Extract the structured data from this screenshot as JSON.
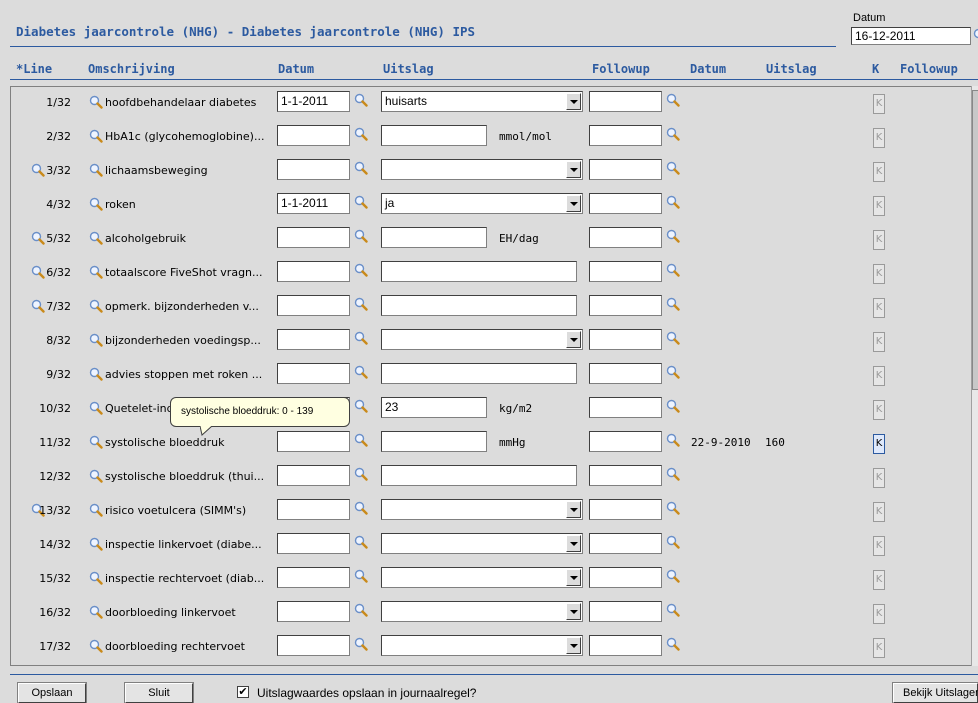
{
  "header": {
    "title": "Diabetes jaarcontrole (NHG) - Diabetes jaarcontrole (NHG) IPS",
    "datum_label": "Datum",
    "datum_value": "16-12-2011"
  },
  "columns": {
    "line": "*Line",
    "omschrijving": "Omschrijving",
    "datum": "Datum",
    "uitslag": "Uitslag",
    "followup": "Followup",
    "datum_prev": "Datum",
    "uitslag_prev": "Uitslag",
    "k": "K",
    "followup_prev": "Followup"
  },
  "rows": [
    {
      "num": "1/32",
      "desc": "hoofdbehandelaar diabetes",
      "date": "1-1-2011",
      "result": "huisarts",
      "unit": "",
      "type": "select",
      "prev_date": "",
      "prev_value": "",
      "row_lens": false
    },
    {
      "num": "2/32",
      "desc": "HbA1c (glycohemoglobine)...",
      "date": "",
      "result": "",
      "unit": "mmol/mol",
      "type": "text",
      "prev_date": "",
      "prev_value": "",
      "row_lens": false
    },
    {
      "num": "3/32",
      "desc": "lichaamsbeweging",
      "date": "",
      "result": "",
      "unit": "",
      "type": "select",
      "prev_date": "",
      "prev_value": "",
      "row_lens": true
    },
    {
      "num": "4/32",
      "desc": "roken",
      "date": "1-1-2011",
      "result": "ja",
      "unit": "",
      "type": "select",
      "prev_date": "",
      "prev_value": "",
      "row_lens": false
    },
    {
      "num": "5/32",
      "desc": "alcoholgebruik",
      "date": "",
      "result": "",
      "unit": "EH/dag",
      "type": "text",
      "prev_date": "",
      "prev_value": "",
      "row_lens": true
    },
    {
      "num": "6/32",
      "desc": "totaalscore FiveShot vragn...",
      "date": "",
      "result": "",
      "unit": "",
      "type": "wide",
      "prev_date": "",
      "prev_value": "",
      "row_lens": true
    },
    {
      "num": "7/32",
      "desc": "opmerk. bijzonderheden v...",
      "date": "",
      "result": "",
      "unit": "",
      "type": "wide",
      "prev_date": "",
      "prev_value": "",
      "row_lens": true
    },
    {
      "num": "8/32",
      "desc": "bijzonderheden voedingsp...",
      "date": "",
      "result": "",
      "unit": "",
      "type": "select",
      "prev_date": "",
      "prev_value": "",
      "row_lens": false
    },
    {
      "num": "9/32",
      "desc": "advies stoppen met roken ...",
      "date": "",
      "result": "",
      "unit": "",
      "type": "wide",
      "prev_date": "",
      "prev_value": "",
      "row_lens": false
    },
    {
      "num": "10/32",
      "desc": "Quetelet-index",
      "date": "",
      "result": "23",
      "unit": "kg/m2",
      "type": "text",
      "prev_date": "",
      "prev_value": "",
      "row_lens": false
    },
    {
      "num": "11/32",
      "desc": "systolische bloeddruk",
      "date": "",
      "result": "",
      "unit": "mmHg",
      "type": "text",
      "prev_date": "22-9-2010",
      "prev_value": "160",
      "row_lens": false
    },
    {
      "num": "12/32",
      "desc": "systolische bloeddruk (thui...",
      "date": "",
      "result": "",
      "unit": "",
      "type": "wide",
      "prev_date": "",
      "prev_value": "",
      "row_lens": false
    },
    {
      "num": "13/32",
      "desc": "risico voetulcera (SIMM's)",
      "date": "",
      "result": "",
      "unit": "",
      "type": "select",
      "prev_date": "",
      "prev_value": "",
      "row_lens": true
    },
    {
      "num": "14/32",
      "desc": "inspectie linkervoet (diabe...",
      "date": "",
      "result": "",
      "unit": "",
      "type": "select",
      "prev_date": "",
      "prev_value": "",
      "row_lens": false
    },
    {
      "num": "15/32",
      "desc": "inspectie rechtervoet (diab...",
      "date": "",
      "result": "",
      "unit": "",
      "type": "select",
      "prev_date": "",
      "prev_value": "",
      "row_lens": false
    },
    {
      "num": "16/32",
      "desc": "doorbloeding linkervoet",
      "date": "",
      "result": "",
      "unit": "",
      "type": "select",
      "prev_date": "",
      "prev_value": "",
      "row_lens": false
    },
    {
      "num": "17/32",
      "desc": "doorbloeding rechtervoet",
      "date": "",
      "result": "",
      "unit": "",
      "type": "select",
      "prev_date": "",
      "prev_value": "",
      "row_lens": false
    }
  ],
  "k_label": "K",
  "tooltip": "systolische bloeddruk: 0 - 139",
  "footer": {
    "save": "Opslaan",
    "close": "Sluit",
    "checkbox_checked": true,
    "checkbox_label": "Uitslagwaardes opslaan in journaalregel?",
    "view_results": "Bekijk Uitslagen"
  },
  "colors": {
    "accent": "#2c5aa0",
    "background": "#dcdcdc"
  }
}
